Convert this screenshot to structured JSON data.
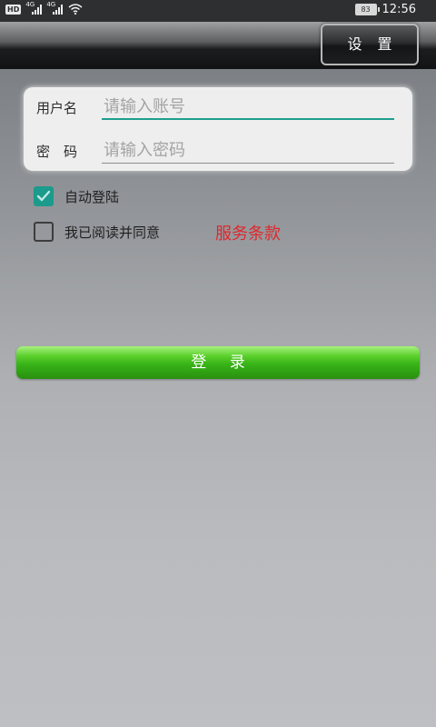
{
  "status_bar": {
    "hd_badge": "HD",
    "signal_label": "4G",
    "battery": "83",
    "time": "12:56"
  },
  "header": {
    "settings_label": "设 置"
  },
  "form": {
    "username_label": "用户名",
    "username_placeholder": "请输入账号",
    "username_value": "",
    "password_label": "密　码",
    "password_placeholder": "请输入密码",
    "password_value": ""
  },
  "options": {
    "auto_login_label": "自动登陆",
    "auto_login_checked": true,
    "agree_label": "我已阅读并同意",
    "agree_checked": false,
    "terms_link": "服务条款"
  },
  "login_button": "登 录",
  "colors": {
    "accent": "#1c9b8c",
    "link_red": "#e0272c",
    "button_green": "#38b318"
  },
  "icons": [
    "hd-icon",
    "signal-icon",
    "wifi-icon",
    "battery-icon",
    "checkmark-icon"
  ]
}
